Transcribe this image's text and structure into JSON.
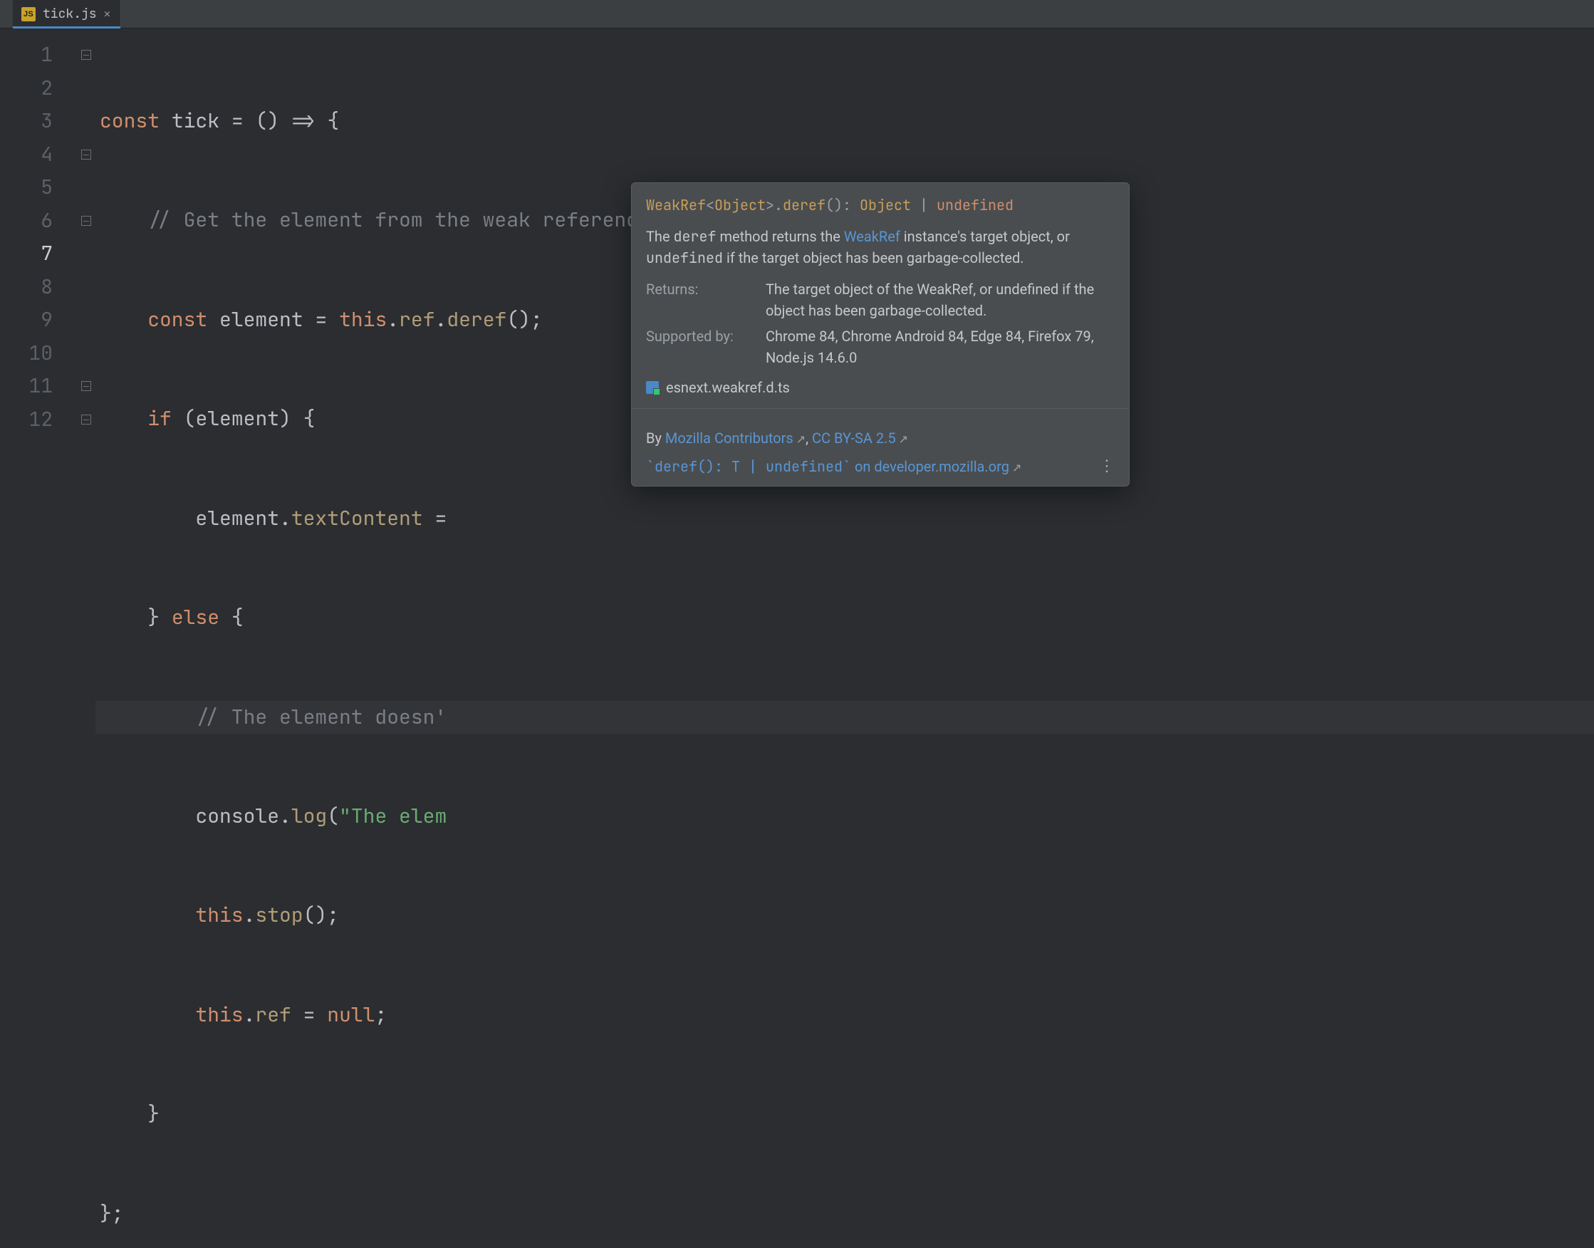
{
  "tab": {
    "filename": "tick.js",
    "file_type_badge": "JS"
  },
  "gutter": {
    "lines": [
      "1",
      "2",
      "3",
      "4",
      "5",
      "6",
      "7",
      "8",
      "9",
      "10",
      "11",
      "12"
    ],
    "current_line_index": 6
  },
  "fold": {
    "marks_at": [
      0,
      3,
      5,
      10,
      11
    ]
  },
  "code": {
    "l1": {
      "kw1": "const",
      "sp1": " ",
      "id1": "tick",
      "sp2": " ",
      "eq": "=",
      "sp3": " ",
      "par": "()",
      "sp4": " ",
      "arrow": "=>",
      "sp5": " ",
      "ob": "{"
    },
    "l2": {
      "indent": "    ",
      "cm": "// Get the element from the weak reference, if it still exists"
    },
    "l3": {
      "indent": "    ",
      "kw1": "const",
      "sp1": " ",
      "id1": "element",
      "sp2": " ",
      "eq": "=",
      "sp3": " ",
      "kw2": "this",
      "dot1": ".",
      "m1": "ref",
      "dot2": ".",
      "m2": "deref",
      "call": "();"
    },
    "l4": {
      "indent": "    ",
      "kw1": "if",
      "sp1": " ",
      "op": "(",
      "id1": "element",
      "cp": ")",
      "sp2": " ",
      "ob": "{"
    },
    "l5": {
      "indent": "        ",
      "id1": "element",
      "dot1": ".",
      "m1": "textContent",
      "sp1": " ",
      "eq": "="
    },
    "l6": {
      "indent": "    ",
      "cb": "}",
      "sp1": " ",
      "kw1": "else",
      "sp2": " ",
      "ob": "{"
    },
    "l7": {
      "indent": "        ",
      "cm": "// The element doesn'"
    },
    "l8": {
      "indent": "        ",
      "id1": "console",
      "dot1": ".",
      "m1": "log",
      "op": "(",
      "str": "\"The elem"
    },
    "l9": {
      "indent": "        ",
      "kw1": "this",
      "dot1": ".",
      "m1": "stop",
      "call": "();"
    },
    "l10": {
      "indent": "        ",
      "kw1": "this",
      "dot1": ".",
      "m1": "ref",
      "sp1": " ",
      "eq": "=",
      "sp2": " ",
      "kw2": "null",
      "semi": ";"
    },
    "l11": {
      "indent": "    ",
      "cb": "}"
    },
    "l12": {
      "cb": "};"
    }
  },
  "popup": {
    "sig": {
      "pre": "WeakRef",
      "lt": "<",
      "obj1": "Object",
      "gt": ">",
      "dot": ".",
      "method": "deref",
      "parens": "()",
      "colon": ": ",
      "ret1": "Object",
      "pipe": "  |  ",
      "ret2": "undefined"
    },
    "body_1": "The ",
    "body_code1": "deref",
    "body_2": " method returns the ",
    "body_link": "WeakRef",
    "body_3": " instance's target object, or ",
    "body_code2": "undefined",
    "body_4": " if the target object has been garbage-collected.",
    "returns_label": "Returns:",
    "returns_value": "The target object of the WeakRef, or undefined if the object has been garbage-collected.",
    "supported_label": "Supported by:",
    "supported_value": "Chrome 84, Chrome Android 84, Edge 84, Firefox 79, Node.js 14.6.0",
    "definition_file": "esnext.weakref.d.ts",
    "by_prefix": "By ",
    "by_link": "Mozilla Contributors",
    "by_sep": ", ",
    "license_link": "CC BY-SA 2.5",
    "mdn_code": "`deref(): T | undefined`",
    "mdn_mid": " on ",
    "mdn_host": "developer.mozilla.org",
    "ext_glyph": "↗",
    "kebab": "⋮"
  }
}
